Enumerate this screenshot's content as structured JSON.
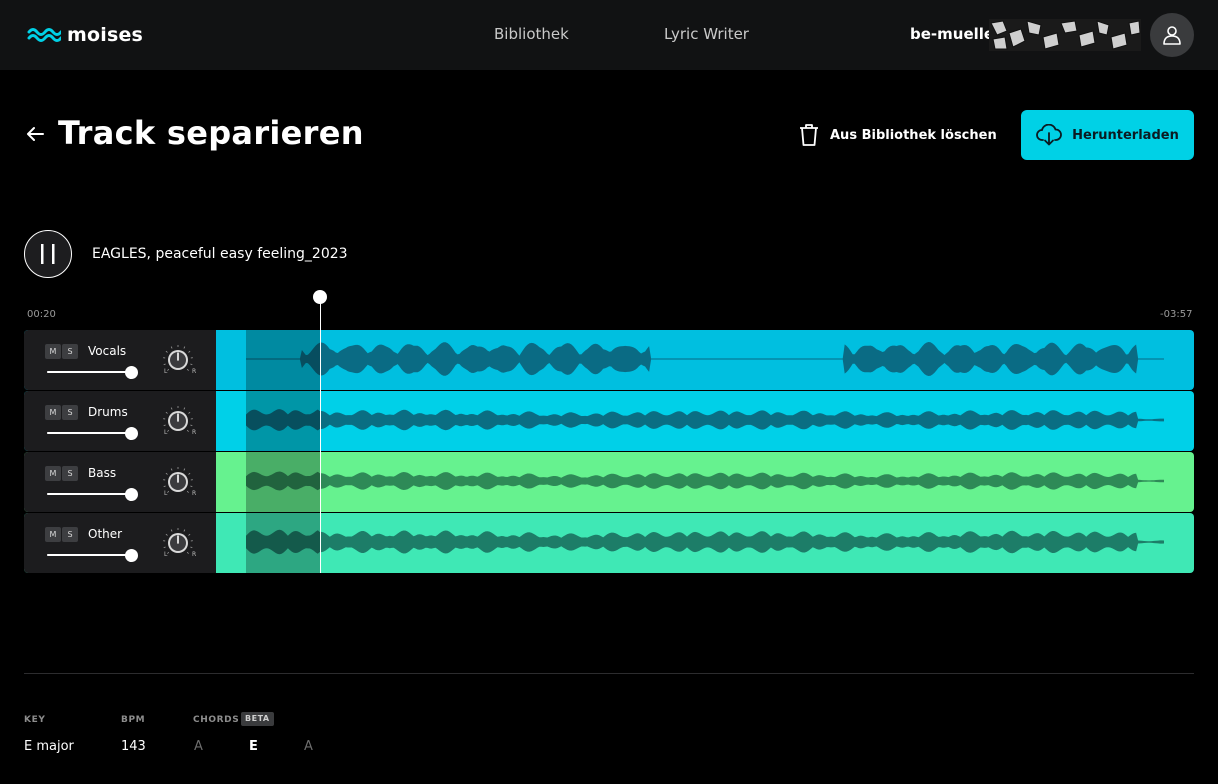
{
  "header": {
    "brand": "moises",
    "nav": [
      "Bibliothek",
      "Lyric Writer"
    ],
    "username": "be-mueller",
    "brand_color": "#00d1e6"
  },
  "page": {
    "title": "Track separieren",
    "delete_label": "Aus Bibliothek löschen",
    "download_label": "Herunterladen"
  },
  "player": {
    "track_name": "EAGLES, peaceful easy feeling_2023",
    "time_elapsed": "00:20",
    "time_remaining": "-03:57",
    "state": "playing"
  },
  "tracks": [
    {
      "name": "Vocals",
      "mute": "M",
      "solo": "S",
      "volume": 1.0,
      "pan_left": "L",
      "pan_right": "R",
      "color": "#00bfe0",
      "wave_color": "#0a6b84"
    },
    {
      "name": "Drums",
      "mute": "M",
      "solo": "S",
      "volume": 1.0,
      "pan_left": "L",
      "pan_right": "R",
      "color": "#00d0e8",
      "wave_color": "#0a6e83"
    },
    {
      "name": "Bass",
      "mute": "M",
      "solo": "S",
      "volume": 1.0,
      "pan_left": "L",
      "pan_right": "R",
      "color": "#66f28f",
      "wave_color": "#2e8a57"
    },
    {
      "name": "Other",
      "mute": "M",
      "solo": "S",
      "volume": 1.0,
      "pan_left": "L",
      "pan_right": "R",
      "color": "#3fe8b5",
      "wave_color": "#1d7d68"
    }
  ],
  "info": {
    "key_label": "KEY",
    "key_value": "E major",
    "bpm_label": "BPM",
    "bpm_value": "143",
    "chords_label": "CHORDS",
    "beta_label": "BETA",
    "chords": [
      {
        "name": "A",
        "active": false
      },
      {
        "name": "E",
        "active": true
      },
      {
        "name": "A",
        "active": false
      }
    ]
  }
}
